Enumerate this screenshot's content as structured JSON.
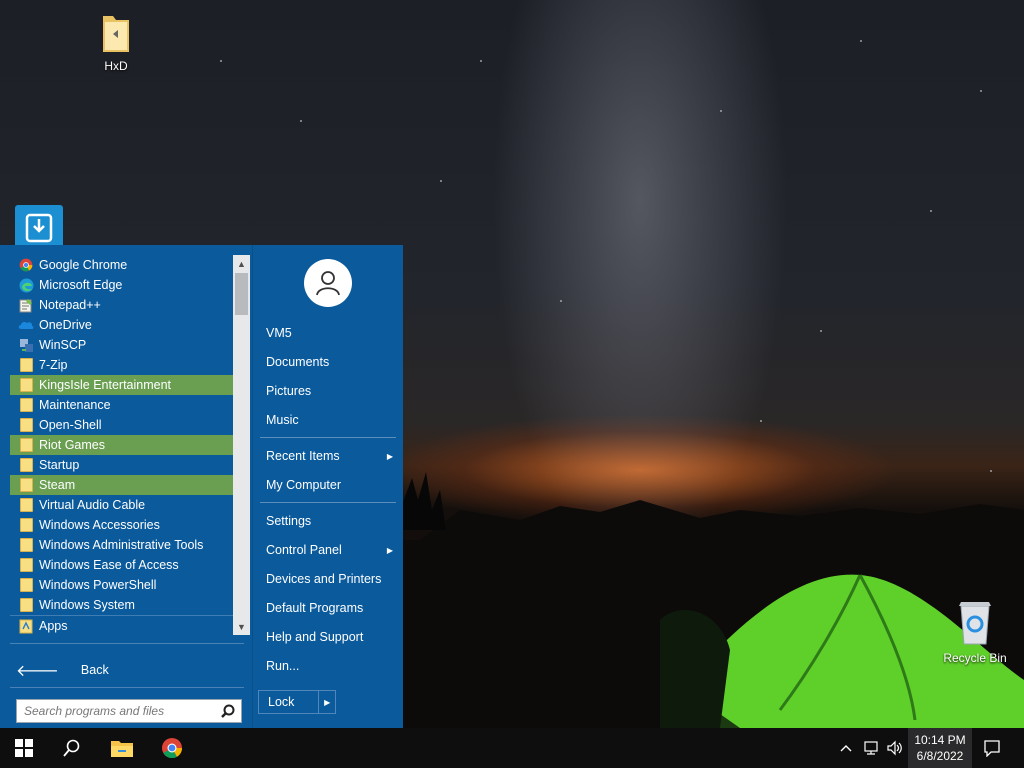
{
  "desktop": {
    "icons": [
      {
        "label": "HxD",
        "icon": "folder-icon"
      },
      {
        "label": "Recycle Bin",
        "icon": "recycle-bin-icon"
      }
    ]
  },
  "start_menu": {
    "programs": [
      {
        "label": "Google Chrome",
        "icon": "chrome-icon",
        "highlighted": false
      },
      {
        "label": "Microsoft Edge",
        "icon": "edge-icon",
        "highlighted": false
      },
      {
        "label": "Notepad++",
        "icon": "notepad-plus-plus-icon",
        "highlighted": false
      },
      {
        "label": "OneDrive",
        "icon": "onedrive-icon",
        "highlighted": false
      },
      {
        "label": "WinSCP",
        "icon": "winscp-icon",
        "highlighted": false
      },
      {
        "label": "7-Zip",
        "icon": "folder-icon",
        "highlighted": false
      },
      {
        "label": "KingsIsle Entertainment",
        "icon": "folder-icon",
        "highlighted": true
      },
      {
        "label": "Maintenance",
        "icon": "folder-icon",
        "highlighted": false
      },
      {
        "label": "Open-Shell",
        "icon": "folder-icon",
        "highlighted": false
      },
      {
        "label": "Riot Games",
        "icon": "folder-icon",
        "highlighted": true
      },
      {
        "label": "Startup",
        "icon": "folder-icon",
        "highlighted": false
      },
      {
        "label": "Steam",
        "icon": "folder-icon",
        "highlighted": true
      },
      {
        "label": "Virtual Audio Cable",
        "icon": "folder-icon",
        "highlighted": false
      },
      {
        "label": "Windows Accessories",
        "icon": "folder-icon",
        "highlighted": false
      },
      {
        "label": "Windows Administrative Tools",
        "icon": "folder-icon",
        "highlighted": false
      },
      {
        "label": "Windows Ease of Access",
        "icon": "folder-icon",
        "highlighted": false
      },
      {
        "label": "Windows PowerShell",
        "icon": "folder-icon",
        "highlighted": false
      },
      {
        "label": "Windows System",
        "icon": "folder-icon",
        "highlighted": false
      },
      {
        "label": "Apps",
        "icon": "apps-folder-icon",
        "highlighted": false
      }
    ],
    "back_label": "Back",
    "search_placeholder": "Search programs and files",
    "user_name": "VM5",
    "right_items": [
      {
        "label": "Documents",
        "submenu": false
      },
      {
        "label": "Pictures",
        "submenu": false
      },
      {
        "label": "Music",
        "submenu": false
      },
      {
        "label": "Recent Items",
        "submenu": true
      },
      {
        "label": "My Computer",
        "submenu": false
      },
      {
        "label": "Settings",
        "submenu": false
      },
      {
        "label": "Control Panel",
        "submenu": true
      },
      {
        "label": "Devices and Printers",
        "submenu": false
      },
      {
        "label": "Default Programs",
        "submenu": false
      },
      {
        "label": "Help and Support",
        "submenu": false
      },
      {
        "label": "Run...",
        "submenu": false
      }
    ],
    "lock_label": "Lock",
    "colors": {
      "menu_bg": "#0a5a9c",
      "highlight": "#6a9f52"
    }
  },
  "taskbar": {
    "time": "10:14 PM",
    "date": "6/8/2022"
  }
}
